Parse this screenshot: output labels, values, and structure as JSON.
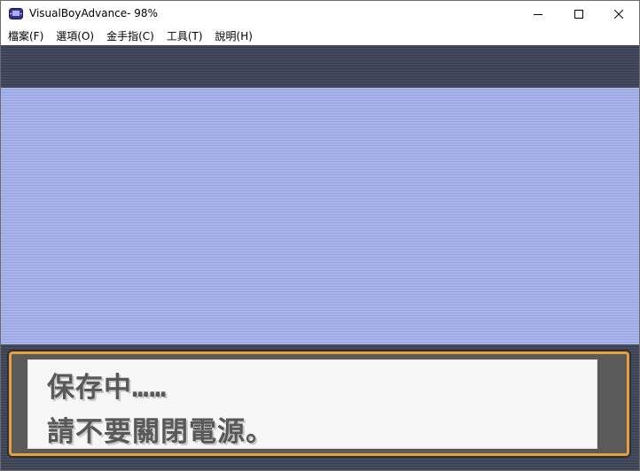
{
  "window": {
    "title": "VisualBoyAdvance- 98%",
    "icon": "gba-icon"
  },
  "menubar": {
    "items": [
      {
        "label": "檔案(F)"
      },
      {
        "label": "選項(O)"
      },
      {
        "label": "金手指(C)"
      },
      {
        "label": "工具(T)"
      },
      {
        "label": "說明(H)"
      }
    ]
  },
  "game": {
    "dialog": {
      "line1": "保存中……",
      "line2": "請不要關閉電源。"
    },
    "colors": {
      "sky": "#a8b4ea",
      "dialog_border": "#e8a038",
      "dialog_text": "#595959"
    }
  }
}
